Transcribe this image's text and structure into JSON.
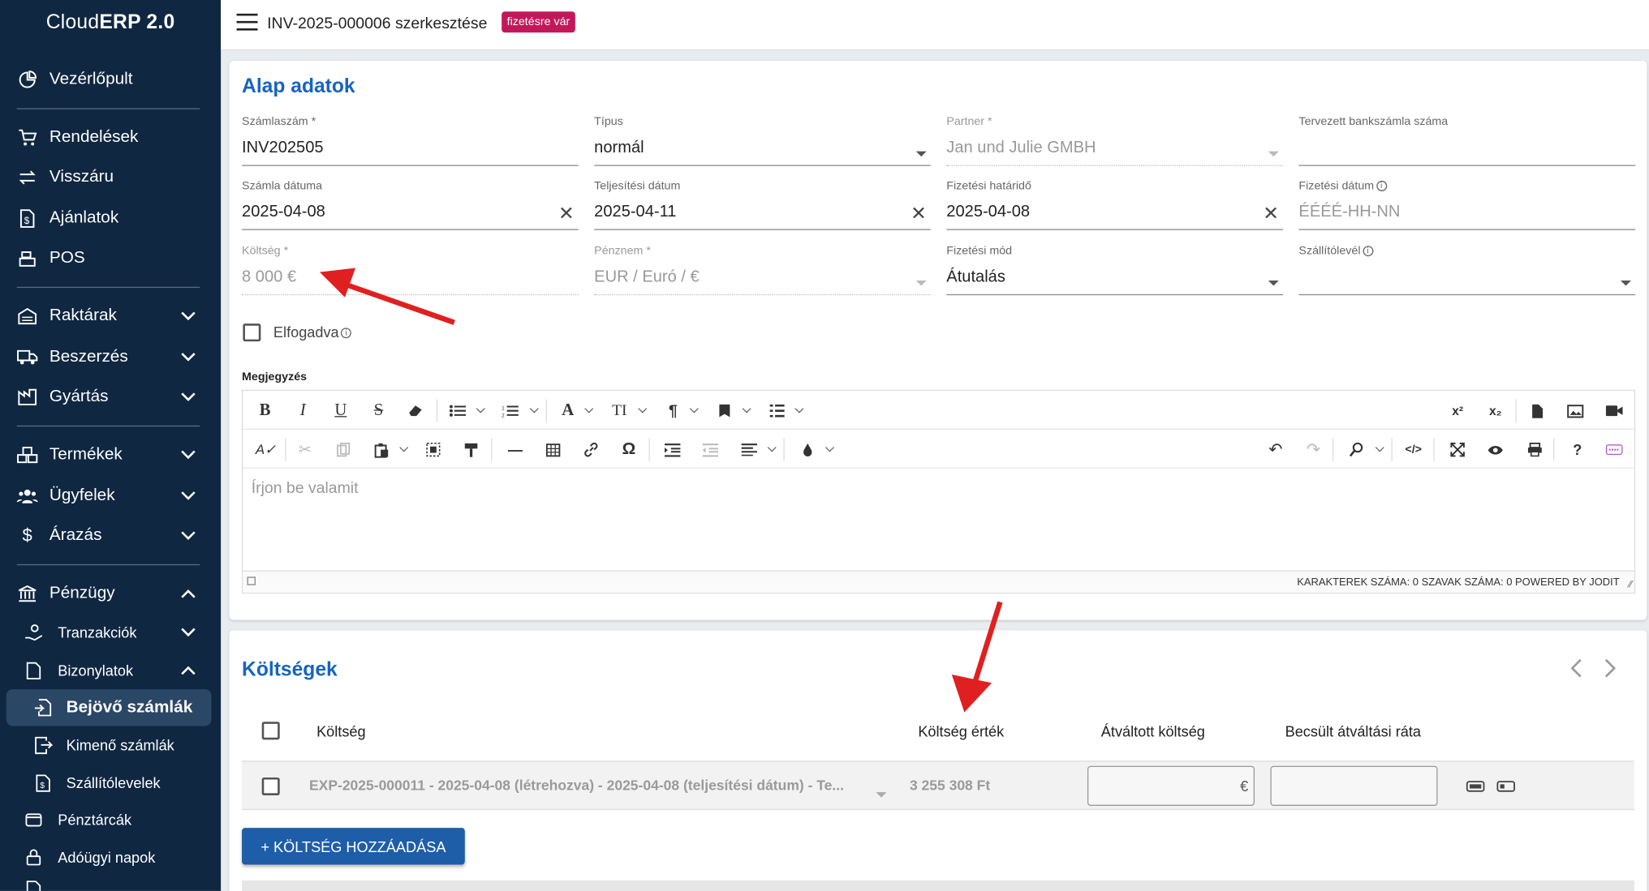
{
  "app": {
    "title_prefix": "Cloud",
    "title_bold": "ERP 2.0"
  },
  "sidebar": {
    "items": [
      {
        "label": "Vezérlőpult",
        "icon": "dashboard-icon"
      },
      {
        "label": "Rendelések",
        "icon": "cart-icon"
      },
      {
        "label": "Visszáru",
        "icon": "swap-icon"
      },
      {
        "label": "Ajánlatok",
        "icon": "document-dollar-icon"
      },
      {
        "label": "POS",
        "icon": "cash-register-icon"
      },
      {
        "label": "Raktárak",
        "icon": "warehouse-icon"
      },
      {
        "label": "Beszerzés",
        "icon": "truck-icon"
      },
      {
        "label": "Gyártás",
        "icon": "factory-icon"
      },
      {
        "label": "Termékek",
        "icon": "boxes-icon"
      },
      {
        "label": "Ügyfelek",
        "icon": "users-icon"
      },
      {
        "label": "Árazás",
        "icon": "dollar-icon"
      },
      {
        "label": "Pénzügy",
        "icon": "bank-icon"
      },
      {
        "label": "Tranzakciók",
        "icon": "hand-coins-icon"
      },
      {
        "label": "Bizonylatok",
        "icon": "file-icon"
      },
      {
        "label": "Bejövő számlák",
        "icon": "file-import-icon"
      },
      {
        "label": "Kimenő számlák",
        "icon": "file-export-icon"
      },
      {
        "label": "Szállítólevelek",
        "icon": "file-dollar-icon"
      },
      {
        "label": "Pénztárcák",
        "icon": "wallet-icon"
      },
      {
        "label": "Adóügyi napok",
        "icon": "lock-icon"
      }
    ]
  },
  "header": {
    "title": "INV-2025-000006 szerkesztése",
    "status": "fizetésre vár"
  },
  "basic": {
    "title": "Alap adatok",
    "fields": {
      "invoice_no": {
        "label": "Számlaszám *",
        "value": "INV202505"
      },
      "type": {
        "label": "Típus",
        "value": "normál"
      },
      "partner": {
        "label": "Partner *",
        "value": "Jan und Julie GMBH"
      },
      "bank_account": {
        "label": "Tervezett bankszámla száma",
        "value": ""
      },
      "invoice_date": {
        "label": "Számla dátuma",
        "value": "2025-04-08"
      },
      "fulfillment_date": {
        "label": "Teljesítési dátum",
        "value": "2025-04-11"
      },
      "due_date": {
        "label": "Fizetési határidő",
        "value": "2025-04-08"
      },
      "payment_date": {
        "label": "Fizetési dátum",
        "placeholder": "ÉÉÉÉ-HH-NN"
      },
      "cost": {
        "label": "Költség *",
        "value": "8 000 €"
      },
      "currency": {
        "label": "Pénznem *",
        "value": "EUR / Euró / €"
      },
      "payment_method": {
        "label": "Fizetési mód",
        "value": "Átutalás"
      },
      "delivery_note": {
        "label": "Szállítólevél",
        "value": ""
      }
    },
    "accepted_label": "Elfogadva",
    "note_label": "Megjegyzés",
    "editor": {
      "placeholder": "Írjon be valamit",
      "status": "KARAKTEREK SZÁMA: 0   SZAVAK SZÁMA: 0   POWERED BY JODIT"
    }
  },
  "costs": {
    "title": "Költségek",
    "columns": [
      "Költség",
      "Költség érték",
      "Átváltott költség",
      "Becsült átváltási ráta"
    ],
    "rows": [
      {
        "expense": "EXP-2025-000011 - 2025-04-08 (létrehozva) - 2025-04-08 (teljesítési dátum) - Te...",
        "value": "3 255 308 Ft",
        "converted_suffix": "€"
      }
    ],
    "add_button": "+ KÖLTSÉG HOZZÁADÁSA"
  },
  "colors": {
    "sidebar_bg": "#0f2741",
    "accent": "#1565c0",
    "badge": "#c2185b",
    "annotation_arrow": "#e02020"
  }
}
